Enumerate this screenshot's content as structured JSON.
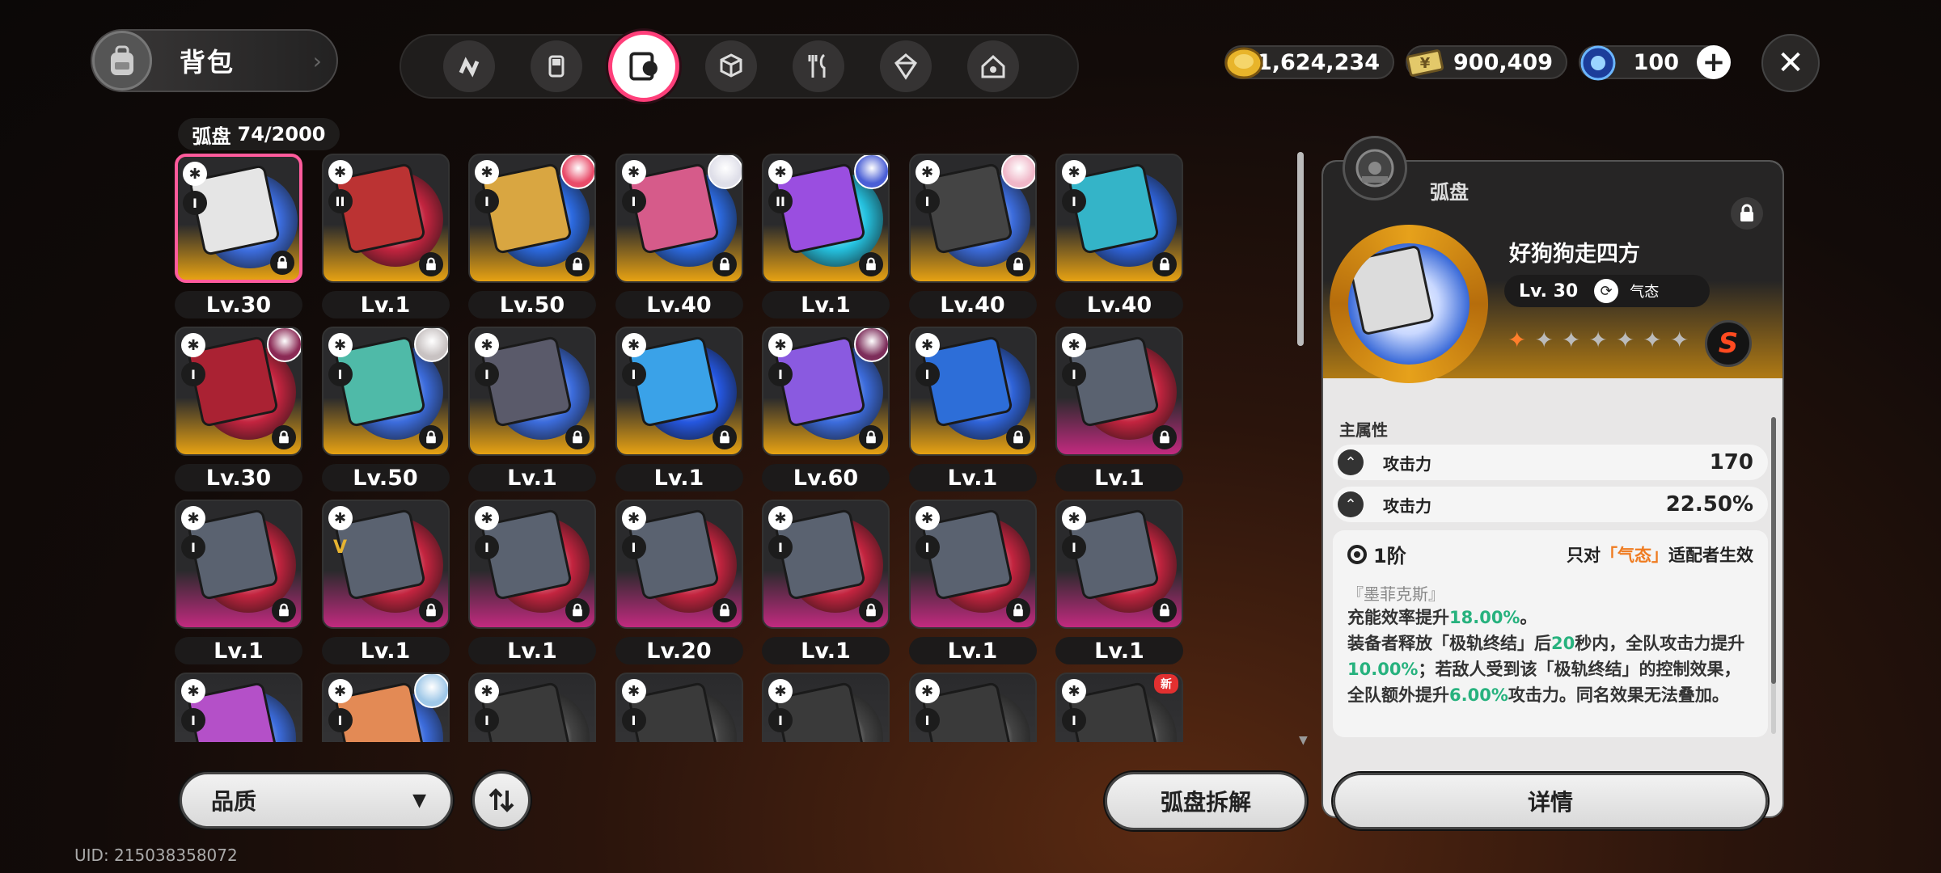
{
  "header": {
    "title": "背包",
    "tabs": [
      {
        "name": "drive-tab",
        "icon": "n-logo-icon"
      },
      {
        "name": "gameboy-tab",
        "icon": "gameboy-icon"
      },
      {
        "name": "disc-tab",
        "icon": "disc-drive-icon",
        "active": true
      },
      {
        "name": "cube-tab",
        "icon": "cube-icon"
      },
      {
        "name": "food-tab",
        "icon": "fork-knife-icon"
      },
      {
        "name": "crystal-tab",
        "icon": "crystal-icon"
      },
      {
        "name": "house-tab",
        "icon": "house-icon"
      }
    ],
    "currencies": [
      {
        "name": "gold-coin",
        "value": "1,624,234",
        "color": "#e8b42a"
      },
      {
        "name": "ticket",
        "value": "900,409",
        "color": "#e3c96a"
      },
      {
        "name": "energy",
        "value": "100",
        "color": "#3a8bf0"
      }
    ]
  },
  "inventory": {
    "label": "弧盘",
    "count": "74/2000"
  },
  "grid": [
    {
      "lv": "Lv.30",
      "rank": "I",
      "bg": "gold",
      "disc": "#3c6cdc",
      "case": "#e5e5e5",
      "selected": true
    },
    {
      "lv": "Lv.1",
      "rank": "II",
      "bg": "gold",
      "disc": "#c3243f",
      "case": "#b33"
    },
    {
      "lv": "Lv.50",
      "rank": "I",
      "bg": "gold",
      "disc": "#2c6ae0",
      "case": "#d9a641",
      "avatar": "#e94b69"
    },
    {
      "lv": "Lv.40",
      "rank": "I",
      "bg": "gold",
      "disc": "#2c6ae0",
      "case": "#d65b8a",
      "avatar": "#dfdfe9"
    },
    {
      "lv": "Lv.1",
      "rank": "II",
      "bg": "gold",
      "disc": "#25c2e0",
      "case": "#9a4ee0",
      "avatar": "#4a5fd6"
    },
    {
      "lv": "Lv.40",
      "rank": "I",
      "bg": "gold",
      "disc": "#3c6cdc",
      "case": "#444",
      "avatar": "#f0b7c8"
    },
    {
      "lv": "Lv.40",
      "rank": "I",
      "bg": "gold",
      "disc": "#2f63d8",
      "case": "#34b4c8"
    },
    {
      "lv": "Lv.30",
      "rank": "I",
      "bg": "gold",
      "disc": "#c3243f",
      "case": "#a23",
      "avatar": "#8b2a55"
    },
    {
      "lv": "Lv.50",
      "rank": "I",
      "bg": "gold",
      "disc": "#3c6cdc",
      "case": "#4fbaa8",
      "avatar": "#c8c2c2"
    },
    {
      "lv": "Lv.1",
      "rank": "I",
      "bg": "gold",
      "disc": "#3c6cdc",
      "case": "#5a5a6a"
    },
    {
      "lv": "Lv.1",
      "rank": "I",
      "bg": "gold",
      "disc": "#2557e0",
      "case": "#3aa2e8"
    },
    {
      "lv": "Lv.60",
      "rank": "I",
      "bg": "gold",
      "disc": "#3c6cdc",
      "case": "#8a5ae0",
      "avatar": "#7d2d5a"
    },
    {
      "lv": "Lv.1",
      "rank": "I",
      "bg": "gold",
      "disc": "#2f63d8",
      "case": "#2d6ed8"
    },
    {
      "lv": "Lv.1",
      "rank": "I",
      "bg": "purple",
      "disc": "#c3243f",
      "case": "#5a6270"
    },
    {
      "lv": "Lv.1",
      "rank": "I",
      "bg": "purple",
      "disc": "#c3243f",
      "case": "#5a6270"
    },
    {
      "lv": "Lv.1",
      "rank": "V",
      "bg": "purple",
      "disc": "#c3243f",
      "case": "#5a6270"
    },
    {
      "lv": "Lv.1",
      "rank": "I",
      "bg": "purple",
      "disc": "#c3243f",
      "case": "#5a6270"
    },
    {
      "lv": "Lv.20",
      "rank": "I",
      "bg": "purple",
      "disc": "#c3243f",
      "case": "#5a6270"
    },
    {
      "lv": "Lv.1",
      "rank": "I",
      "bg": "purple",
      "disc": "#c3243f",
      "case": "#5a6270"
    },
    {
      "lv": "Lv.1",
      "rank": "I",
      "bg": "purple",
      "disc": "#c3243f",
      "case": "#5a6270"
    },
    {
      "lv": "Lv.1",
      "rank": "I",
      "bg": "purple",
      "disc": "#c3243f",
      "case": "#5a6270"
    },
    {
      "lv": "",
      "rank": "I",
      "bg": "gray",
      "disc": "#3c6cdc",
      "case": "#b450c8"
    },
    {
      "lv": "",
      "rank": "I",
      "bg": "gray",
      "disc": "#3c6cdc",
      "case": "#e38a55",
      "avatar": "#9fc8e8"
    },
    {
      "lv": "",
      "rank": "I",
      "bg": "gray",
      "disc": "#444",
      "case": "#3a3a3a"
    },
    {
      "lv": "",
      "rank": "I",
      "bg": "gray",
      "disc": "#444",
      "case": "#3a3a3a"
    },
    {
      "lv": "",
      "rank": "I",
      "bg": "gray",
      "disc": "#444",
      "case": "#3a3a3a"
    },
    {
      "lv": "",
      "rank": "I",
      "bg": "gray",
      "disc": "#444",
      "case": "#3a3a3a"
    },
    {
      "lv": "",
      "rank": "I",
      "bg": "gray",
      "disc": "#444",
      "case": "#3a3a3a",
      "new": "新"
    }
  ],
  "controls": {
    "quality_label": "品质",
    "dismantle_label": "弧盘拆解",
    "uid": "UID: 215038358072"
  },
  "detail": {
    "category": "弧盘",
    "name": "好狗狗走四方",
    "level": "Lv. 30",
    "attribute": "气态",
    "stars_lit": 1,
    "stars_total": 7,
    "rank_badge": "S",
    "main_attr_title": "主属性",
    "stats": [
      {
        "name": "攻击力",
        "value": "170"
      },
      {
        "name": "攻击力",
        "value": "22.50%"
      }
    ],
    "set": {
      "tier": "1阶",
      "only_prefix": "只对",
      "only_attr": "「气态」",
      "only_suffix": "适配者生效",
      "set_name": "『墨菲克斯』",
      "desc_parts": [
        {
          "t": "充能效率提升",
          "c": ""
        },
        {
          "t": "18.00%",
          "c": "green"
        },
        {
          "t": "。",
          "c": ""
        },
        {
          "t": "装备者释放「极轨终结」后",
          "c": ""
        },
        {
          "t": "20",
          "c": "green"
        },
        {
          "t": "秒内，全队攻击力提升",
          "c": ""
        },
        {
          "t": "10.00%",
          "c": "green"
        },
        {
          "t": "；若敌人受到该「极轨终结」的控制效果，全队额外提升",
          "c": ""
        },
        {
          "t": "6.00%",
          "c": "green"
        },
        {
          "t": "攻击力。同名效果无法叠加。",
          "c": ""
        }
      ]
    },
    "details_label": "详情"
  }
}
